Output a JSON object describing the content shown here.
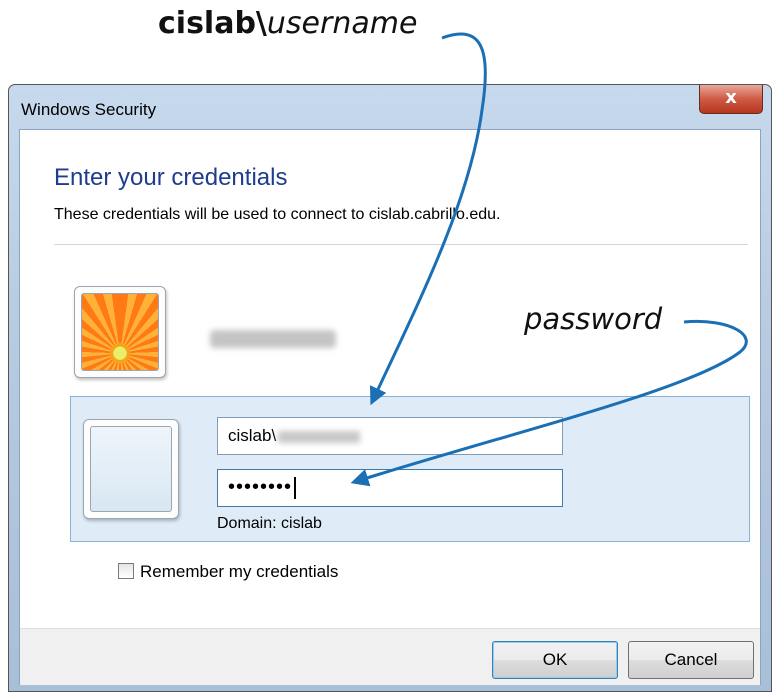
{
  "annotations": {
    "username_prefix": "cislab\\",
    "username_italic": "username",
    "password": "password"
  },
  "window": {
    "title": "Windows Security",
    "close_symbol": "x"
  },
  "dialog": {
    "heading": "Enter your credentials",
    "subtext": "These credentials will be used to connect to cislab.cabrillo.edu."
  },
  "credentials": {
    "username_value": "cislab\\",
    "password_value": "••••••••",
    "domain_label": "Domain: cislab"
  },
  "remember": {
    "label": "Remember my credentials"
  },
  "buttons": {
    "ok": "OK",
    "cancel": "Cancel"
  },
  "icons": {
    "user_tile": "flower-user-tile",
    "blank_tile": "blank-user-tile",
    "close": "close-icon"
  },
  "colors": {
    "heading": "#1e3d8f",
    "arrow": "#1a6fb5",
    "close_button": "#cf5a45"
  }
}
